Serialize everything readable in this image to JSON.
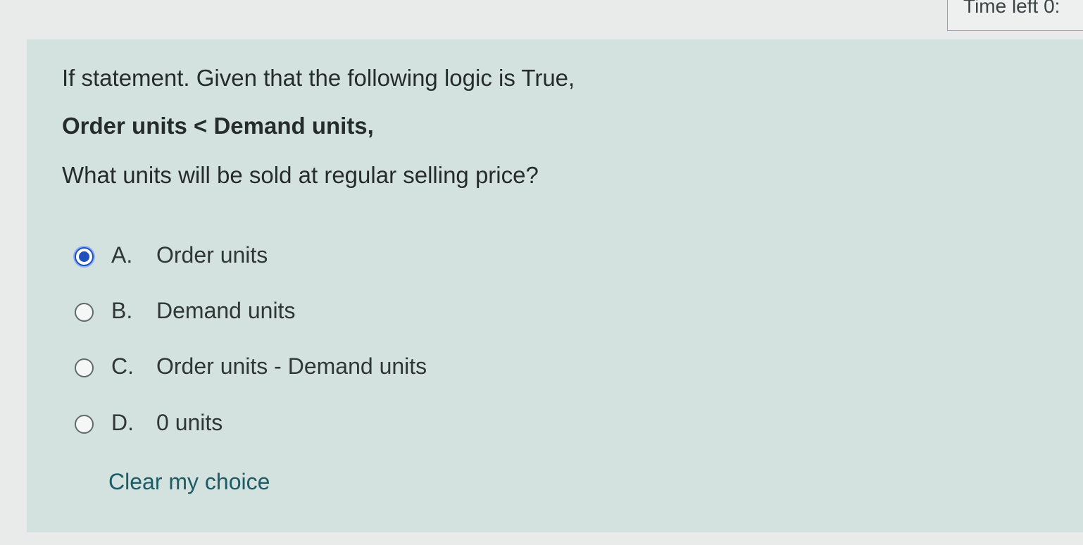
{
  "timer": {
    "label": "Time left 0:"
  },
  "question": {
    "intro": "If statement. Given that the following logic is True,",
    "condition": "Order units < Demand units,",
    "prompt": "What units will be sold at regular selling price?"
  },
  "answers": [
    {
      "letter": "A.",
      "text": "Order units",
      "selected": true
    },
    {
      "letter": "B.",
      "text": "Demand units",
      "selected": false
    },
    {
      "letter": "C.",
      "text": "Order units - Demand units",
      "selected": false
    },
    {
      "letter": "D.",
      "text": "0 units",
      "selected": false
    }
  ],
  "clear_choice_label": "Clear my choice",
  "colors": {
    "panel_background": "#d3e2de",
    "selected_radio": "#1f4fb8",
    "link": "#1d5b66"
  }
}
